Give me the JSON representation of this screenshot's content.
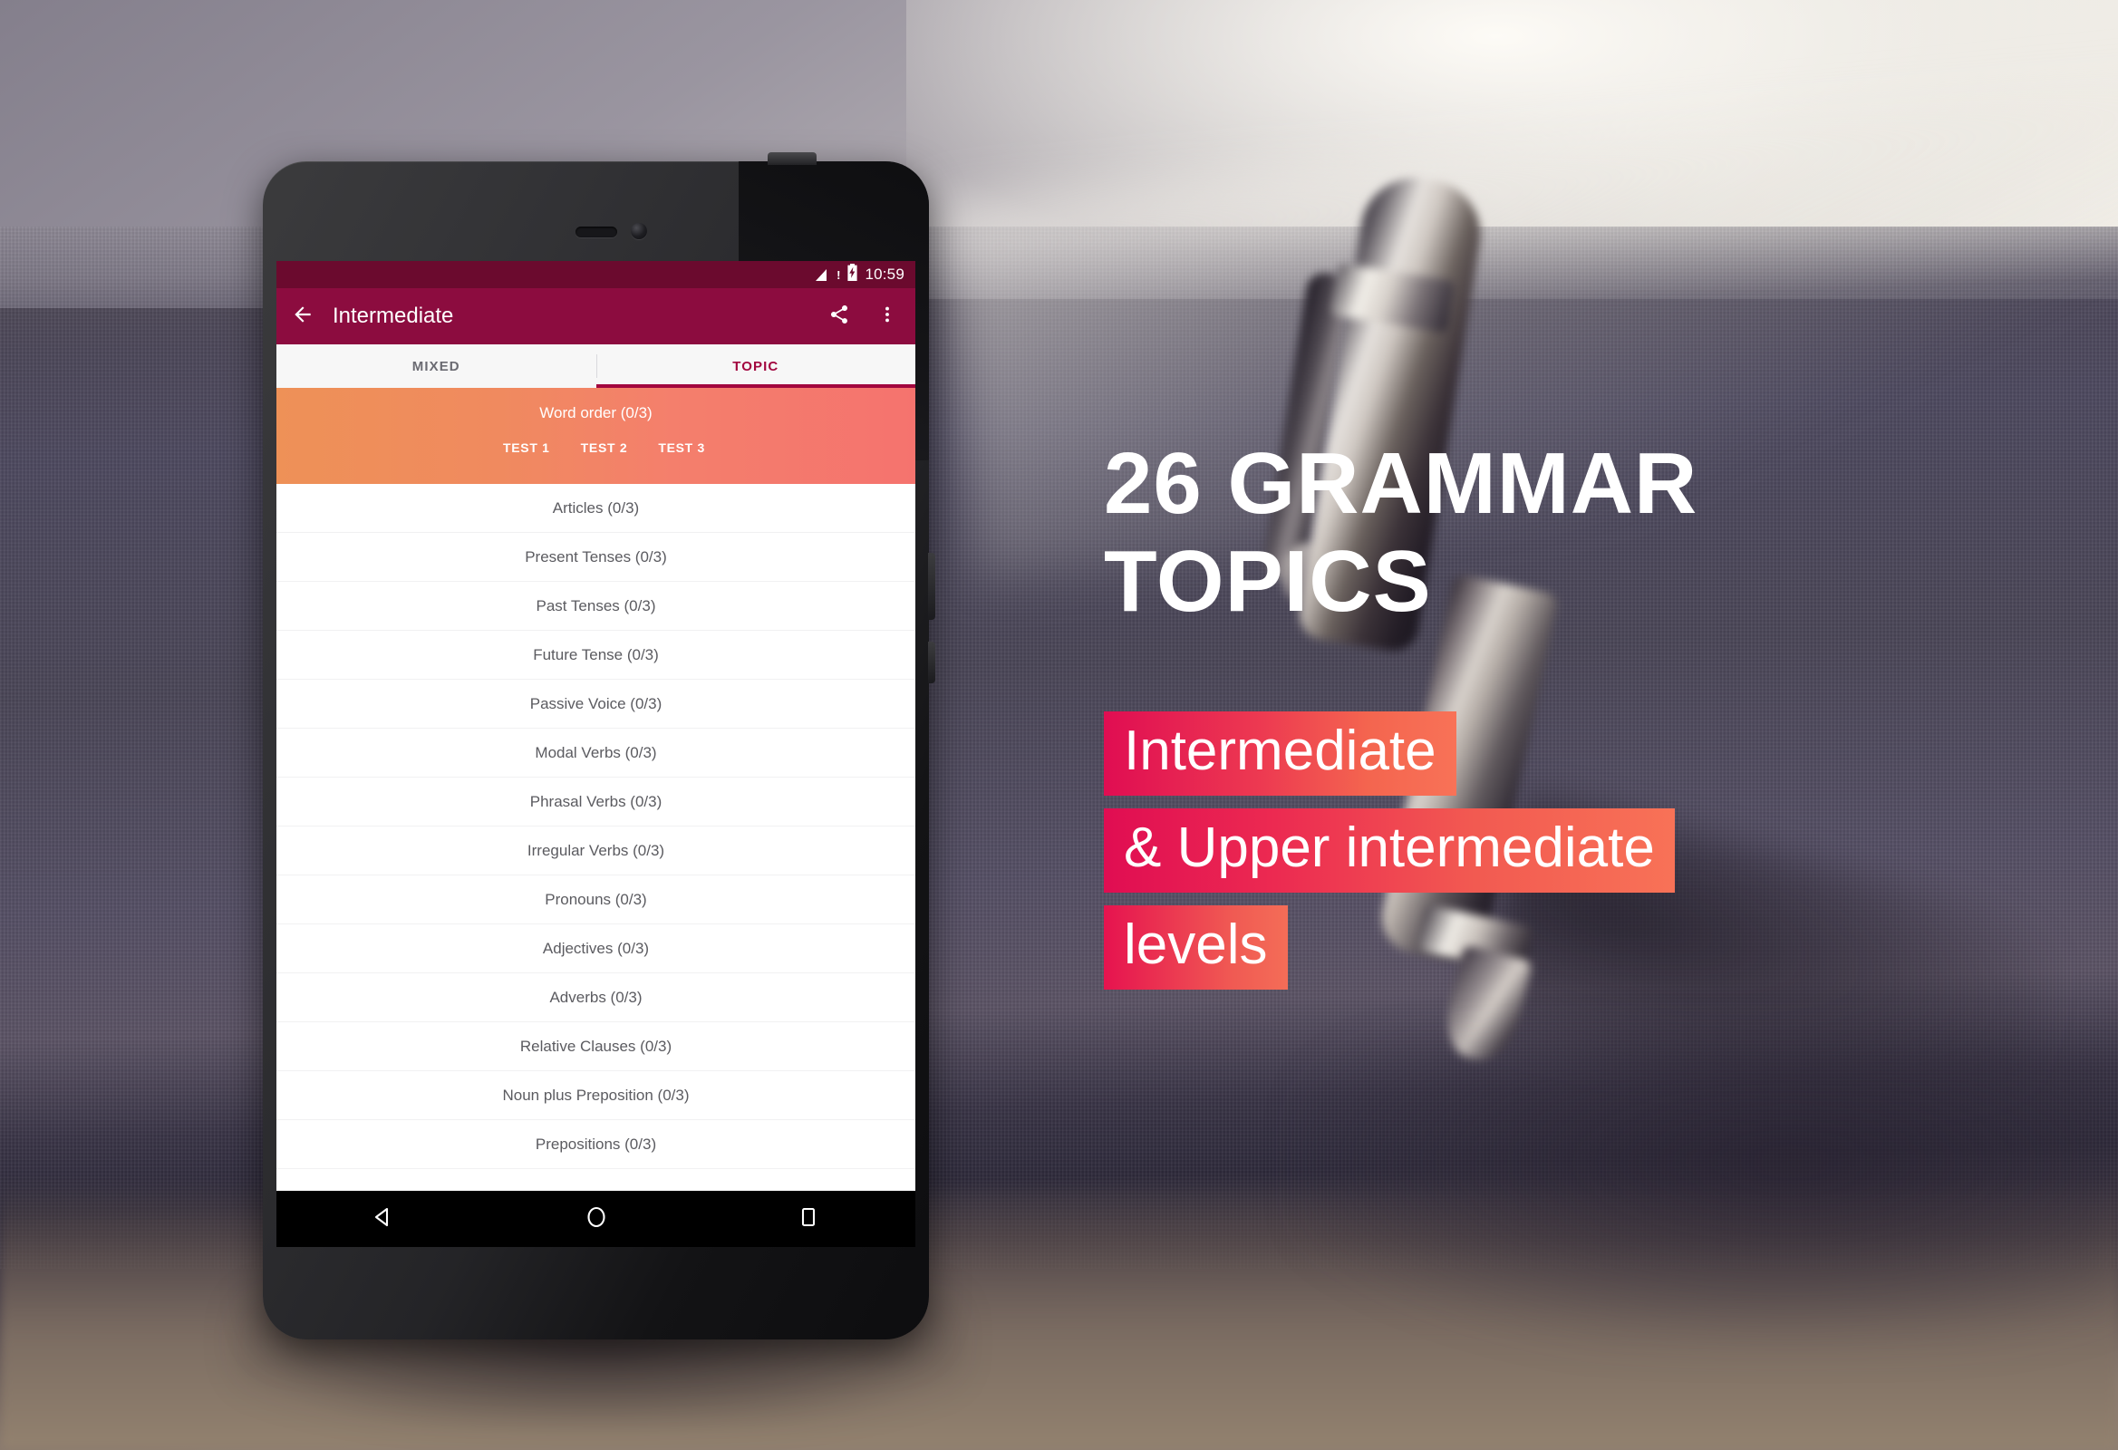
{
  "background": {
    "description": "blurred photo of a metallic pen lying on dark woven fabric notebook",
    "photo_icon": "pen-photo"
  },
  "promo": {
    "headline_line1": "26 GRAMMAR",
    "headline_line2": "TOPICS",
    "bars": [
      "Intermediate",
      "& Upper intermediate",
      "levels"
    ],
    "colors": {
      "headline": "#FFFFFF",
      "bar_gradient_start": "#E00D52",
      "bar_gradient_end": "#F87257"
    }
  },
  "device": {
    "type": "android-tablet",
    "frame_color": "#2B2B2E"
  },
  "screen": {
    "status_bar": {
      "time": "10:59",
      "signal_icon": "signal-bars-icon",
      "signal_warning": "!",
      "battery_icon": "battery-charging-icon",
      "background": "#6B0A2E"
    },
    "app_bar": {
      "back_icon": "arrow-left-icon",
      "title": "Intermediate",
      "share_icon": "share-icon",
      "overflow_icon": "more-vertical-icon",
      "background": "#8C0C3F"
    },
    "tabs": [
      {
        "label": "MIXED",
        "active": false
      },
      {
        "label": "TOPIC",
        "active": true
      }
    ],
    "tab_accent": "#A2073F",
    "highlighted_topic": {
      "title": "Word order (0/3)",
      "tests": [
        "TEST 1",
        "TEST 2",
        "TEST 3"
      ],
      "gradient_start": "#EE9157",
      "gradient_end": "#F5736E"
    },
    "topics": [
      "Articles (0/3)",
      "Present Tenses (0/3)",
      "Past Tenses (0/3)",
      "Future Tense (0/3)",
      "Passive Voice (0/3)",
      "Modal Verbs (0/3)",
      "Phrasal Verbs (0/3)",
      "Irregular Verbs (0/3)",
      "Pronouns (0/3)",
      "Adjectives (0/3)",
      "Adverbs (0/3)",
      "Relative Clauses (0/3)",
      "Noun plus Preposition (0/3)",
      "Prepositions (0/3)"
    ],
    "nav_bar": {
      "back_icon": "nav-back-triangle-icon",
      "home_icon": "nav-home-circle-icon",
      "recents_icon": "nav-recents-square-icon"
    }
  }
}
